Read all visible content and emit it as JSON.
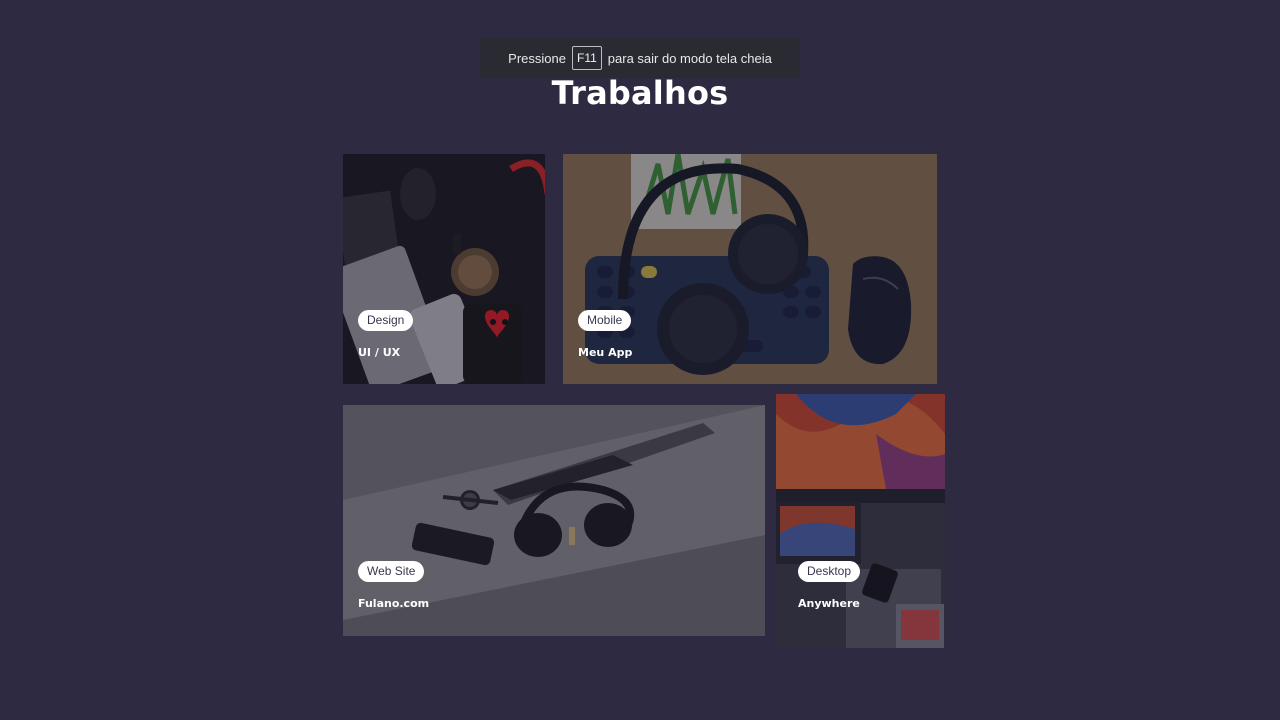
{
  "fullscreen_notice": {
    "prefix": "Pressione",
    "key": "F11",
    "suffix": "para sair do modo tela cheia"
  },
  "page": {
    "title": "Trabalhos"
  },
  "projects": [
    {
      "tag": "Design",
      "title": "UI / UX"
    },
    {
      "tag": "Mobile",
      "title": "Meu App"
    },
    {
      "tag": "Web Site",
      "title": "Fulano.com"
    },
    {
      "tag": "Desktop",
      "title": "Anywhere"
    }
  ],
  "colors": {
    "background": "#2e2a42",
    "tag_background": "#ffffff",
    "tag_text": "#3a3550"
  }
}
